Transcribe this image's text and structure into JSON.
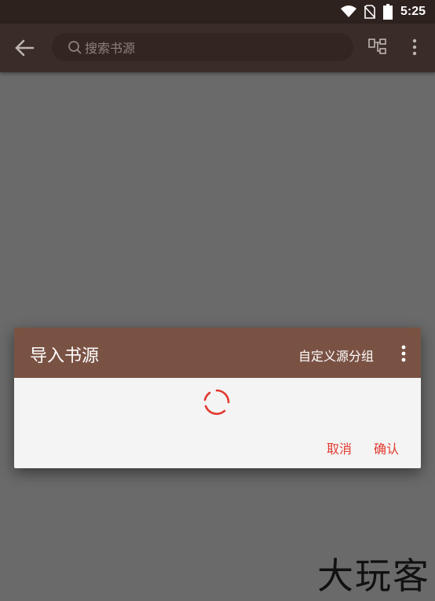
{
  "status_bar": {
    "time": "5:25",
    "icons": [
      "wifi-icon",
      "no-sim-icon",
      "battery-icon"
    ]
  },
  "toolbar": {
    "back_icon": "arrow-left-icon",
    "search_placeholder": "搜索书源",
    "search_icon": "search-icon",
    "actions": [
      "tree-structure-icon",
      "more-vert-icon"
    ]
  },
  "dialog": {
    "title": "导入书源",
    "group_button": "自定义源分组",
    "more_icon": "more-vert-icon",
    "loading_icon": "loading-spinner-icon",
    "cancel_label": "取消",
    "confirm_label": "确认"
  },
  "watermark": "大玩客",
  "colors": {
    "statusbar_bg": "#2e221f",
    "toolbar_bg": "#3a2c27",
    "dialog_header_bg": "#7a5244",
    "accent": "#e23a2f",
    "scrim": "#6a6a6a"
  }
}
